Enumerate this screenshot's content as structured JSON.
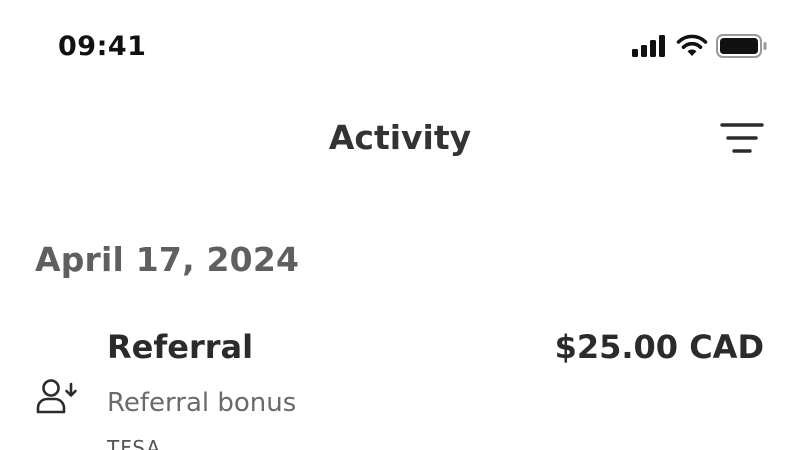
{
  "status_bar": {
    "time": "09:41",
    "icons": [
      "cellular-signal-icon",
      "wifi-icon",
      "battery-icon"
    ]
  },
  "nav": {
    "title": "Activity",
    "filter_icon": "filter-lines-icon"
  },
  "sections": [
    {
      "date": "April 17, 2024",
      "transactions": [
        {
          "icon": "person-receive-icon",
          "title": "Referral",
          "amount": "$25.00 CAD",
          "subtitle": "Referral bonus",
          "reference": "TFSA"
        }
      ]
    }
  ],
  "colors": {
    "background": "#ffffff",
    "primary_text": "#2b2b2b",
    "secondary_text": "#6a6a6a"
  }
}
